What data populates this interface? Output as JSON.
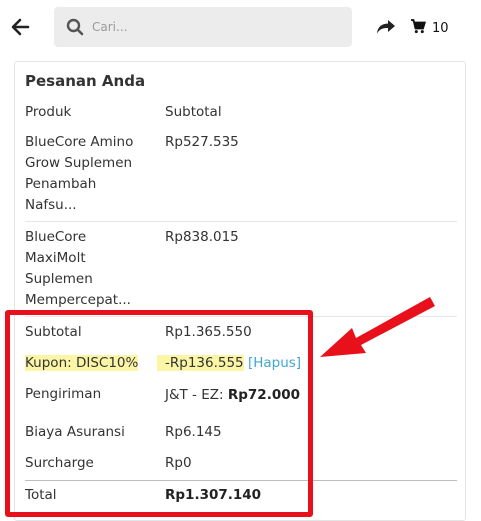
{
  "header": {
    "search_placeholder": "Cari...",
    "cart_count": "10"
  },
  "order": {
    "title": "Pesanan Anda",
    "col_product": "Produk",
    "col_subtotal": "Subtotal",
    "items": [
      {
        "name": "BlueCore Amino Grow Suplemen Penambah Nafsu...",
        "price": "Rp527.535"
      },
      {
        "name": "BlueCore MaxiMolt Suplemen Mempercepat...",
        "price": "Rp838.015"
      }
    ],
    "summary": {
      "subtotal_label": "Subtotal",
      "subtotal_value": "Rp1.365.550",
      "coupon_label": "Kupon: DISC10%",
      "coupon_value": "-Rp136.555",
      "coupon_remove": "[Hapus]",
      "shipping_label": "Pengiriman",
      "shipping_method": "J&T - EZ:",
      "shipping_value": "Rp72.000",
      "insurance_label": "Biaya Asuransi",
      "insurance_value": "Rp6.145",
      "surcharge_label": "Surcharge",
      "surcharge_value": "Rp0",
      "total_label": "Total",
      "total_value": "Rp1.307.140"
    }
  },
  "colors": {
    "annotation": "#e8101a",
    "highlight": "#fbf6a6",
    "link": "#3ea6d4"
  }
}
